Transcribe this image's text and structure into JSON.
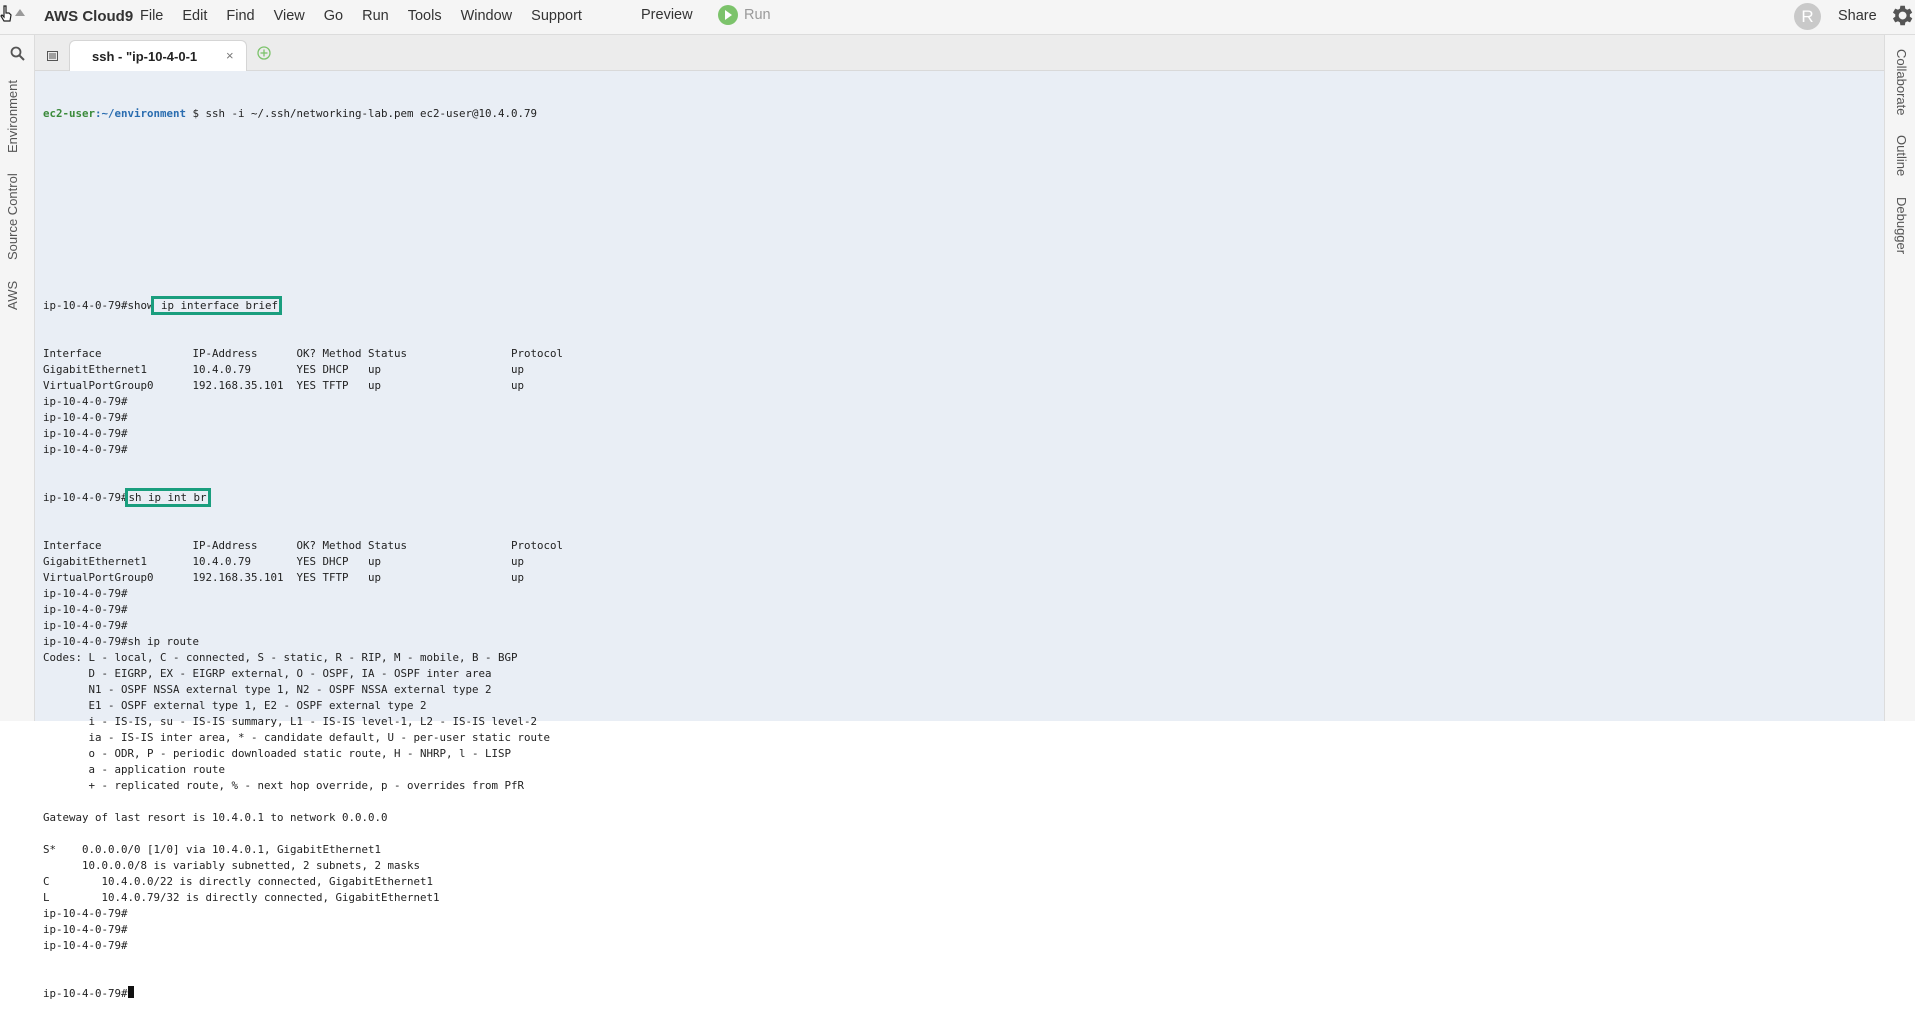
{
  "menubar": {
    "brand": "AWS Cloud9",
    "items": [
      "File",
      "Edit",
      "Find",
      "View",
      "Go",
      "Run",
      "Tools",
      "Window",
      "Support"
    ],
    "preview": "Preview",
    "run": "Run",
    "avatar_initial": "R",
    "share": "Share"
  },
  "left_sidebar": {
    "tabs": [
      "Environment",
      "Source Control",
      "AWS"
    ]
  },
  "right_sidebar": {
    "tabs": [
      "Collaborate",
      "Outline",
      "Debugger"
    ]
  },
  "tabbar": {
    "tab_label": "ssh - \"ip-10-4-0-1",
    "close": "×"
  },
  "terminal": {
    "first": {
      "user": "ec2-user",
      "path": ":~/environment",
      "command": " $ ssh -i ~/.ssh/networking-lab.pem ec2-user@10.4.0.79"
    },
    "cmd1_prefix": "ip-10-4-0-79#show",
    "cmd1_highlight": " ip interface brief",
    "block1": [
      "Interface              IP-Address      OK? Method Status                Protocol",
      "GigabitEthernet1       10.4.0.79       YES DHCP   up                    up",
      "VirtualPortGroup0      192.168.35.101  YES TFTP   up                    up",
      "ip-10-4-0-79#",
      "ip-10-4-0-79#",
      "ip-10-4-0-79#",
      "ip-10-4-0-79#"
    ],
    "cmd2_prefix": "ip-10-4-0-79#",
    "cmd2_highlight": "sh ip int br",
    "block2": [
      "Interface              IP-Address      OK? Method Status                Protocol",
      "GigabitEthernet1       10.4.0.79       YES DHCP   up                    up",
      "VirtualPortGroup0      192.168.35.101  YES TFTP   up                    up",
      "ip-10-4-0-79#",
      "ip-10-4-0-79#",
      "ip-10-4-0-79#",
      "ip-10-4-0-79#sh ip route",
      "Codes: L - local, C - connected, S - static, R - RIP, M - mobile, B - BGP",
      "       D - EIGRP, EX - EIGRP external, O - OSPF, IA - OSPF inter area",
      "       N1 - OSPF NSSA external type 1, N2 - OSPF NSSA external type 2",
      "       E1 - OSPF external type 1, E2 - OSPF external type 2",
      "       i - IS-IS, su - IS-IS summary, L1 - IS-IS level-1, L2 - IS-IS level-2",
      "       ia - IS-IS inter area, * - candidate default, U - per-user static route",
      "       o - ODR, P - periodic downloaded static route, H - NHRP, l - LISP",
      "       a - application route",
      "       + - replicated route, % - next hop override, p - overrides from PfR",
      "",
      "Gateway of last resort is 10.4.0.1 to network 0.0.0.0",
      "",
      "S*    0.0.0.0/0 [1/0] via 10.4.0.1, GigabitEthernet1",
      "      10.0.0.0/8 is variably subnetted, 2 subnets, 2 masks",
      "C        10.4.0.0/22 is directly connected, GigabitEthernet1",
      "L        10.4.0.79/32 is directly connected, GigabitEthernet1",
      "ip-10-4-0-79#",
      "ip-10-4-0-79#",
      "ip-10-4-0-79#"
    ],
    "last_prompt": "ip-10-4-0-79#"
  },
  "colors": {
    "terminal_bg": "#e9eef5",
    "highlight": "#1a9e7e",
    "run_green": "#7cc36b",
    "prompt_user": "#3a8a3a",
    "prompt_path": "#2a6db0"
  },
  "icons": [
    "cursor-icon",
    "collapse-arrow-icon",
    "run-play-icon",
    "gear-icon",
    "search-icon",
    "tab-menu-icon",
    "close-icon",
    "add-tab-icon"
  ]
}
